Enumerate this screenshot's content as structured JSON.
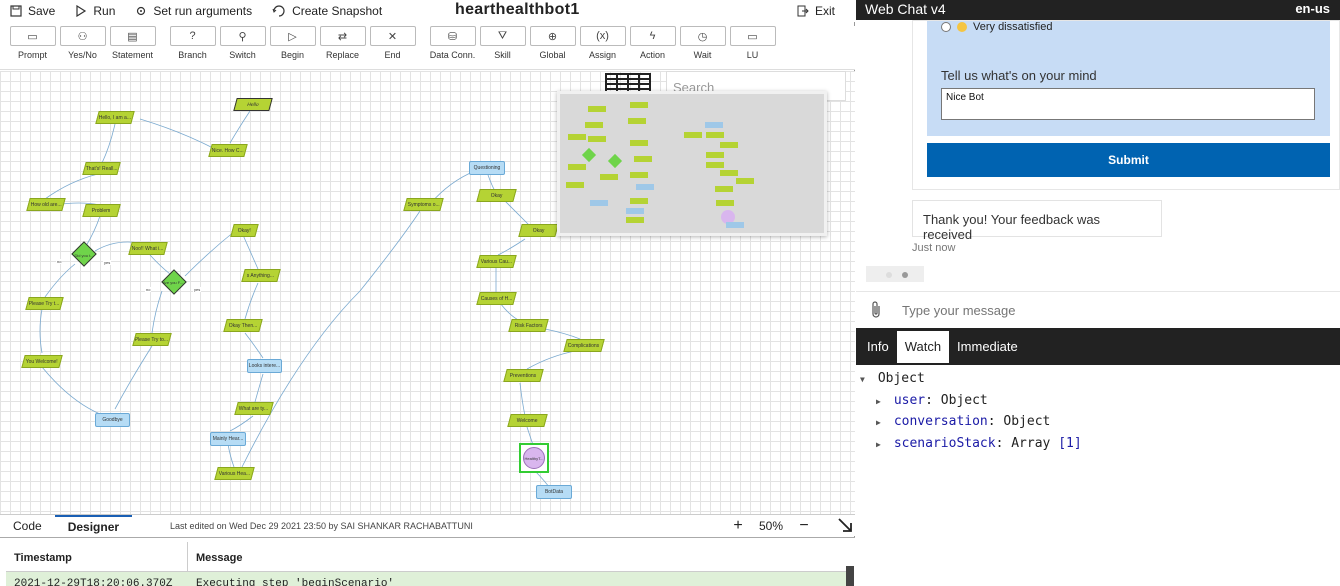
{
  "toolbar": {
    "save": "Save",
    "run": "Run",
    "set_run_args": "Set run arguments",
    "create_snapshot": "Create Snapshot",
    "title": "hearthealthbot1",
    "exit": "Exit"
  },
  "palette": {
    "items": [
      {
        "label": "Prompt",
        "glyph": "▭"
      },
      {
        "label": "Yes/No",
        "glyph": "⚇"
      },
      {
        "label": "Statement",
        "glyph": "▤"
      },
      {
        "label": "Branch",
        "glyph": "?"
      },
      {
        "label": "Switch",
        "glyph": "⚲"
      },
      {
        "label": "Begin",
        "glyph": "▷"
      },
      {
        "label": "Replace",
        "glyph": "⇄"
      },
      {
        "label": "End",
        "glyph": "✕"
      },
      {
        "label": "Data Conn.",
        "glyph": "⛁"
      },
      {
        "label": "Skill",
        "glyph": "⛛"
      },
      {
        "label": "Global",
        "glyph": "⊕"
      },
      {
        "label": "Assign",
        "glyph": "(x)"
      },
      {
        "label": "Action",
        "glyph": "ϟ"
      },
      {
        "label": "Wait",
        "glyph": "◷"
      },
      {
        "label": "LU",
        "glyph": "▭"
      }
    ]
  },
  "canvas": {
    "search_placeholder": "Search",
    "nodes": {
      "hello": "Hello",
      "hello_i_am": "Hello, I am a...",
      "nice_how": "Nice. How C...",
      "thats_reall": "That's! Reall...",
      "how_old": "How old are...",
      "problem": "Problem",
      "did_you": "Did you t...",
      "noo_what": "Noo!! What i...",
      "are_you": "Are you F...",
      "please_try_1": "Please Try t...",
      "please_try_2": "Please Try to...",
      "you_welcome": "You Welcome!",
      "goodbye": "Goodbye",
      "okay_1": "Okay!",
      "anything": "s Anything...",
      "okay_then": "Okay Then...",
      "looks_intere": "Looks intere...",
      "what_are": "What are ty...",
      "mainly_hear": "Mainly Hear...",
      "various_hea": "Various Hea...",
      "symptoms": "Symptoms o...",
      "questioning": "Questioning",
      "okay_2": "Okay",
      "okay_3": "Okay",
      "various_cau": "Various Cau...",
      "causes": "Causes of H...",
      "risk_factors": "Risk Factors",
      "complications": "Complications",
      "preventions": "Preventions",
      "welcome": "Welcome",
      "healthy": "HealthyT...",
      "botdata": "BotData"
    },
    "diamond_labels": {
      "no": "no",
      "yes": "yes"
    }
  },
  "bottom": {
    "tab_code": "Code",
    "tab_designer": "Designer",
    "last_edited": "Last edited on Wed Dec 29 2021 23:50 by SAI SHANKAR RACHABATTUNI",
    "zoom": "50%"
  },
  "log": {
    "col_timestamp": "Timestamp",
    "col_message": "Message",
    "row_timestamp": "2021-12-29T18:20:06.370Z",
    "row_message": "Executing step 'beginScenario'"
  },
  "webchat": {
    "title": "Web Chat v4",
    "locale": "en-us",
    "radio_option": "Very dissatisfied",
    "mind_label": "Tell us what's on your mind",
    "mind_value": "Nice Bot",
    "submit": "Submit",
    "bot_message": "Thank you! Your feedback was received",
    "timestamp": "Just now",
    "input_placeholder": "Type your message"
  },
  "debugger": {
    "tabs": [
      "Info",
      "Watch",
      "Immediate"
    ],
    "active_tab": "Watch",
    "root": "Object",
    "entries": [
      {
        "key": "user",
        "value": "Object"
      },
      {
        "key": "conversation",
        "value": "Object"
      },
      {
        "key": "scenarioStack",
        "value": "Array",
        "extra": "[1]"
      }
    ]
  },
  "colors": {
    "node_green": "#b5d334",
    "node_blue": "#b6dcf5",
    "diamond_green": "#6fd44a",
    "submit_blue": "#0063b1",
    "card_bg": "#c7dcf5"
  }
}
